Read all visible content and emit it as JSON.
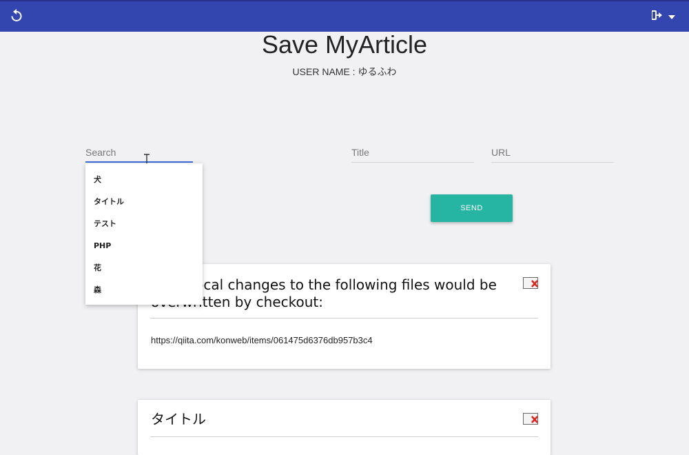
{
  "header": {
    "bar_color": "#3346b0",
    "refresh_icon": "refresh-icon",
    "account_icon": "logout-icon",
    "menu_caret_icon": "caret-down-icon"
  },
  "page": {
    "title": "Save MyArticle",
    "username": "USER NAME : ゆるふわ"
  },
  "form": {
    "search_placeholder": "Search",
    "title_placeholder": "Title",
    "url_placeholder": "URL",
    "send_label": "SEND",
    "send_color": "#26b5a2"
  },
  "dropdown": {
    "options": [
      "犬",
      "タイトル",
      "テスト",
      "PHP",
      "花",
      "森"
    ]
  },
  "cards": [
    {
      "title": "...our local changes to the following files would be overwritten by checkout:",
      "url": "https://qiita.com/konweb/items/061475d6376db957b3c4"
    },
    {
      "title": "タイトル",
      "url": ""
    }
  ]
}
